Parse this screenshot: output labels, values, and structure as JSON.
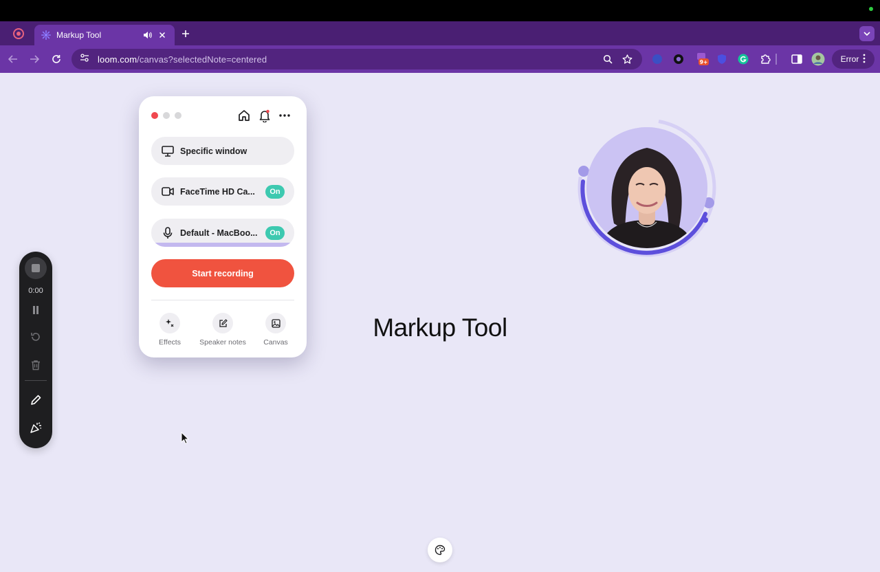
{
  "browser": {
    "tab": {
      "title": "Markup Tool"
    },
    "address": {
      "host": "loom.com",
      "path": "/canvas?selectedNote=centered"
    },
    "extensions_badge": "9+",
    "profile_button_label": "Error"
  },
  "popup": {
    "source_label": "Specific window",
    "camera_label": "FaceTime HD Ca...",
    "camera_status": "On",
    "mic_label": "Default - MacBoo...",
    "mic_status": "On",
    "start_label": "Start recording",
    "footer": {
      "effects": "Effects",
      "speaker_notes": "Speaker notes",
      "canvas": "Canvas"
    }
  },
  "recording_toolbar": {
    "timer": "0:00"
  },
  "canvas": {
    "title": "Markup Tool"
  },
  "colors": {
    "accent_red": "#f0533f",
    "on_badge": "#3dc9b0",
    "tab_strip": "#4a1f73",
    "toolbar": "#6b35a6",
    "canvas_bg": "#e9e7f7",
    "bubble_ring": "#6d5ce0"
  }
}
